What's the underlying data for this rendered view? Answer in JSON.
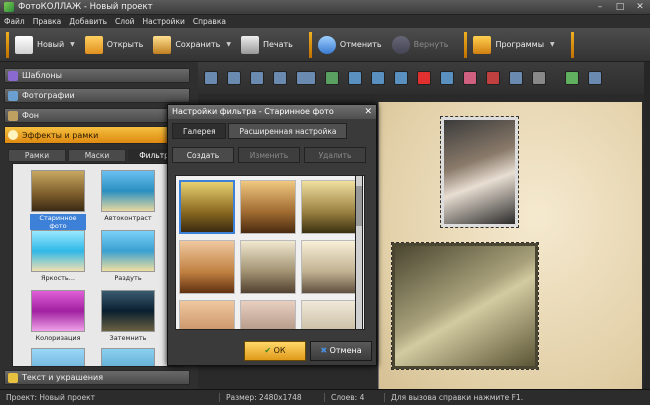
{
  "title": "ФотоКОЛЛАЖ - Новый проект",
  "menu": [
    "Файл",
    "Правка",
    "Добавить",
    "Слой",
    "Настройки",
    "Справка"
  ],
  "toolbar": {
    "new": "Новый",
    "open": "Открыть",
    "save": "Сохранить",
    "print": "Печать",
    "undo": "Отменить",
    "redo": "Вернуть",
    "programs": "Программы"
  },
  "left_panel": {
    "sections": [
      "Шаблоны",
      "Фотографии",
      "Фон",
      "Эффекты и рамки"
    ],
    "bottom_section": "Текст и украшения",
    "subtabs": [
      "Рамки",
      "Маски",
      "Фильтры"
    ],
    "filters": [
      "Старинное фото",
      "Автоконтраст",
      "Яркость...",
      "Раздуть",
      "Колоризация",
      "Затемнить"
    ]
  },
  "dialog": {
    "title": "Настройки фильтра - Старинное фото",
    "tabs": [
      "Галерея",
      "Расширенная настройка"
    ],
    "buttons": {
      "create": "Создать",
      "edit": "Изменить",
      "delete": "Удалить"
    },
    "ok": "ОК",
    "cancel": "Отмена"
  },
  "status": {
    "project": "Проект: Новый проект",
    "size": "Размер: 2480x1748",
    "layers": "Слоев: 4",
    "help": "Для вызова справки нажмите F1."
  },
  "colors": {
    "accent": "#e8a020",
    "selection": "#3d80d8"
  }
}
